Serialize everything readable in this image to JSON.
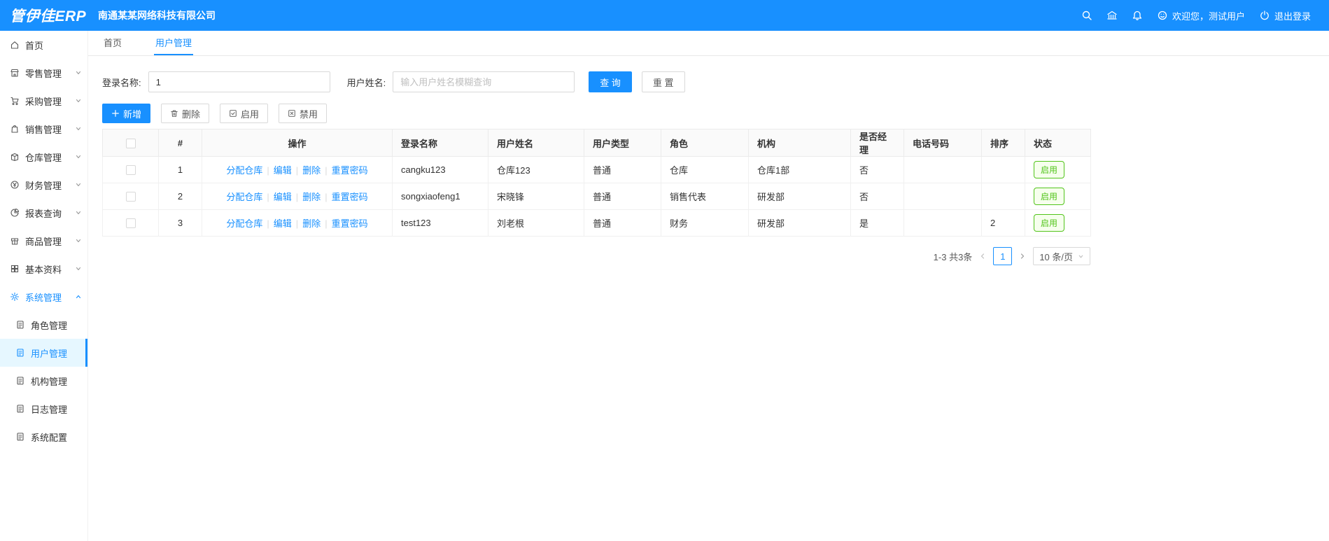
{
  "topbar": {
    "logo": "管伊佳ERP",
    "company": "南通某某网络科技有限公司",
    "welcome": "欢迎您，测试用户",
    "logout": "退出登录"
  },
  "sidebar": {
    "items": [
      {
        "label": "首页"
      },
      {
        "label": "零售管理"
      },
      {
        "label": "采购管理"
      },
      {
        "label": "销售管理"
      },
      {
        "label": "仓库管理"
      },
      {
        "label": "财务管理"
      },
      {
        "label": "报表查询"
      },
      {
        "label": "商品管理"
      },
      {
        "label": "基本资料"
      },
      {
        "label": "系统管理"
      }
    ],
    "system_subitems": [
      {
        "label": "角色管理"
      },
      {
        "label": "用户管理"
      },
      {
        "label": "机构管理"
      },
      {
        "label": "日志管理"
      },
      {
        "label": "系统配置"
      }
    ]
  },
  "tabs": [
    {
      "label": "首页"
    },
    {
      "label": "用户管理"
    }
  ],
  "filter": {
    "login_label": "登录名称:",
    "login_value": "1",
    "name_label": "用户姓名:",
    "name_placeholder": "输入用户姓名模糊查询",
    "search_button": "查 询",
    "reset_button": "重 置"
  },
  "toolbar": {
    "add_button": "新增",
    "delete_button": "删除",
    "enable_button": "启用",
    "disable_button": "禁用"
  },
  "table": {
    "headers": [
      "#",
      "操作",
      "登录名称",
      "用户姓名",
      "用户类型",
      "角色",
      "机构",
      "是否经理",
      "电话号码",
      "排序",
      "状态"
    ],
    "separator": "|",
    "actions": [
      "分配仓库",
      "编辑",
      "删除",
      "重置密码"
    ],
    "rows": [
      {
        "index": "1",
        "login_name": "cangku123",
        "user_name": "仓库123",
        "user_type": "普通",
        "role": "仓库",
        "org": "仓库1部",
        "is_manager": "否",
        "phone": "",
        "sort": "",
        "status": "启用"
      },
      {
        "index": "2",
        "login_name": "songxiaofeng1",
        "user_name": "宋晓锋",
        "user_type": "普通",
        "role": "销售代表",
        "org": "研发部",
        "is_manager": "否",
        "phone": "",
        "sort": "",
        "status": "启用"
      },
      {
        "index": "3",
        "login_name": "test123",
        "user_name": "刘老根",
        "user_type": "普通",
        "role": "财务",
        "org": "研发部",
        "is_manager": "是",
        "phone": "",
        "sort": "2",
        "status": "启用"
      }
    ]
  },
  "pagination": {
    "summary": "1-3 共3条",
    "current_page": "1",
    "page_size": "10 条/页"
  },
  "colors": {
    "primary": "#1890ff",
    "success": "#52c41a"
  }
}
